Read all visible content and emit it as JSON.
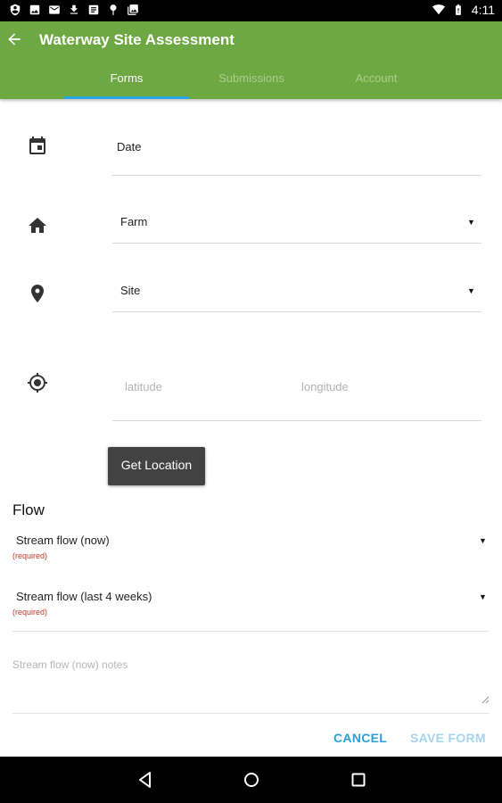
{
  "status_bar": {
    "time": "4:11",
    "left_icons": [
      "shield-icon",
      "image-icon",
      "email-icon",
      "download-icon",
      "document-icon",
      "tack-icon",
      "images-icon"
    ],
    "right_icons": [
      "wifi-icon",
      "battery-icon"
    ]
  },
  "app_bar": {
    "back_icon": "arrow-left-icon",
    "title": "Waterway Site Assessment",
    "tabs": [
      {
        "label": "Forms",
        "active": true
      },
      {
        "label": "Submissions",
        "active": false
      },
      {
        "label": "Account",
        "active": false
      }
    ],
    "color": "#6da842",
    "tab_indicator_color": "#29a6e0"
  },
  "form": {
    "date": {
      "icon": "calendar-icon",
      "value": "Date"
    },
    "farm": {
      "icon": "home-icon",
      "value": "Farm"
    },
    "site": {
      "icon": "location-pin-icon",
      "value": "Site"
    },
    "location": {
      "icon": "gps-target-icon",
      "latitude_placeholder": "latitude",
      "longitude_placeholder": "longitude",
      "button_label": "Get Location"
    },
    "flow": {
      "title": "Flow",
      "stream_flow_now": {
        "label": "Stream flow (now)",
        "note": "(required)"
      },
      "stream_flow_last4": {
        "label": "Stream flow (last 4 weeks)",
        "note": "(required)"
      },
      "notes_placeholder": "Stream flow (now) notes"
    }
  },
  "actions": {
    "cancel": "CANCEL",
    "save": "SAVE FORM",
    "accent": "#2a9fd6"
  },
  "nav_bar": {
    "icons": [
      "back-triangle-icon",
      "home-circle-icon",
      "recents-square-icon"
    ]
  }
}
